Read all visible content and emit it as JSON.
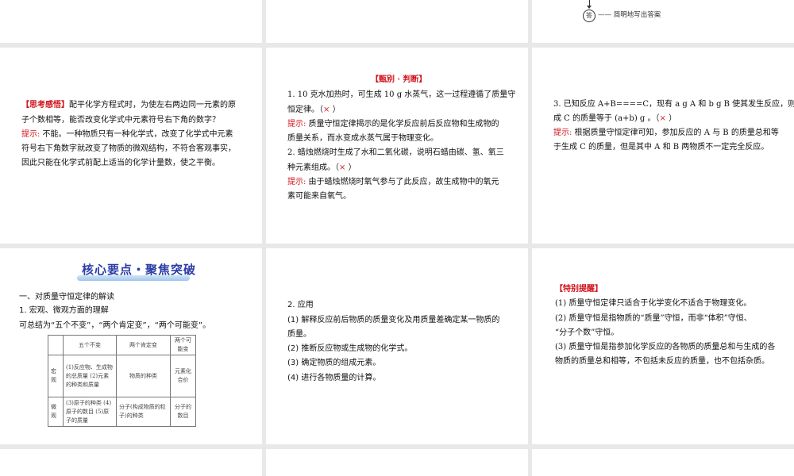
{
  "slide_top_right": {
    "answer_glyph": "答",
    "answer_note": "—— 简明地写出答案"
  },
  "slide_think": {
    "label": "【思考感悟】",
    "question_lines": [
      "配平化学方程式时，为使左右两边同一元素的原",
      "子个数相等，能否改变化学式中元素符号右下角的数字？"
    ],
    "hint_label": "提示:",
    "hint_lines": [
      " 不能。一种物质只有一种化学式，改变了化学式中元素",
      "符号右下角数字就改变了物质的微观结构，不符合客观事实，",
      "因此只能在化学式前配上适当的化学计量数，使之平衡。"
    ]
  },
  "slide_judge": {
    "title": "【甄别 · 判断】",
    "q1_lines": [
      "1. 10 克水加热时，可生成 10  g 水蒸气，这一过程遵循了质量守",
      "恒定律。（"
    ],
    "q1_mark": "×",
    "close": " ）",
    "hint_label": "提示:",
    "h1_lines": [
      " 质量守恒定律揭示的是化学反应前后反应物和生成物的",
      "质量关系，而水变成水蒸气属于物理变化。"
    ],
    "q2_lines": [
      "2. 蜡烛燃烧时生成了水和二氧化碳，说明石蜡由碳、氢、氧三",
      "种元素组成。（"
    ],
    "q2_mark": "×",
    "h2_lines": [
      " 由于蜡烛燃烧时氧气参与了此反应，故生成物中的氧元",
      "素可能来自氧气。"
    ]
  },
  "slide_judge3": {
    "q3_lines": [
      "3. 已知反应 A+B====C，现有 a  g  A 和 b  g  B 使其发生反应，则生",
      "成 C 的质量等于 (a+b)  g 。（"
    ],
    "q3_mark": "×",
    "close": "  ）",
    "hint_label": "提示:",
    "h3_lines": [
      " 根据质量守恒定律可知，参加反应的 A 与 B 的质量总和等",
      "于生成 C 的质量，但是其中 A 和 B 两物质不一定完全反应。"
    ]
  },
  "slide_core": {
    "banner": "核心要点・聚焦突破",
    "section": "一、对质量守恒定律的解读",
    "sub1": "1. 宏观、微观方面的理解",
    "summary": "可总结为“五个不变”，“两个肯定变”，“两个可能变”。",
    "table": {
      "headers": [
        "",
        "五个不变",
        "两个肯定变",
        "两个可能变"
      ],
      "rows": [
        [
          "宏观",
          "(1)反应物、生成物的总质量 (2)元素的种类和质量",
          "物质的种类",
          "元素化合价"
        ],
        [
          "微观",
          "(3)原子的种类 (4)原子的数目 (5)原子的质量",
          "分子(构成物质的粒子)的种类",
          "分子的数目"
        ]
      ]
    }
  },
  "slide_apply": {
    "title": "2. 应用",
    "lines": [
      "(1) 解释反应前后物质的质量变化及用质量差确定某一物质的",
      "质量。",
      "(2) 推断反应物或生成物的化学式。",
      "(3) 确定物质的组成元素。",
      "(4) 进行各物质量的计算。"
    ]
  },
  "slide_remind": {
    "title": "【特别提醒】",
    "lines": [
      "(1) 质量守恒定律只适合于化学变化不适合于物理变化。",
      "(2) 质量守恒是指物质的“质量”守恒，而非“体积”守恒、",
      " “分子个数”守恒。",
      "(3) 质量守恒是指参加化学反应的各物质的质量总和与生成的各",
      "物质的质量总和相等，不包括未反应的质量，也不包括杂质。"
    ]
  }
}
